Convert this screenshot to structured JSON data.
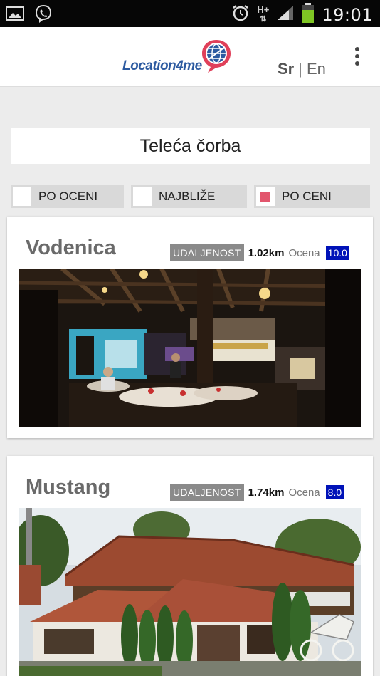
{
  "status_bar": {
    "time": "19:01",
    "network_label": "H+",
    "icons": [
      "image-icon",
      "viber-icon",
      "alarm-icon",
      "signal-icon",
      "battery-icon"
    ]
  },
  "header": {
    "logo_text": "Location4me",
    "lang_sr": "Sr",
    "lang_separator": "|",
    "lang_en": "En"
  },
  "query": {
    "title": "Teleća čorba"
  },
  "sort": {
    "by_rating": "PO OCENI",
    "nearest": "NAJBLIŽE",
    "by_price": "PO CENI",
    "selected": "by_price",
    "accent": "#e2566d"
  },
  "results": [
    {
      "name": "Vodenica",
      "distance_label": "UDALJENOST",
      "distance": "1.02km",
      "rating_label": "Ocena",
      "rating": "10.0"
    },
    {
      "name": "Mustang",
      "distance_label": "UDALJENOST",
      "distance": "1.74km",
      "rating_label": "Ocena",
      "rating": "8.0"
    }
  ],
  "colors": {
    "rating_badge": "#0012b8",
    "distance_badge": "#8a8a8a",
    "logo_blue": "#2c5aa0",
    "logo_pin": "#e0405a"
  }
}
